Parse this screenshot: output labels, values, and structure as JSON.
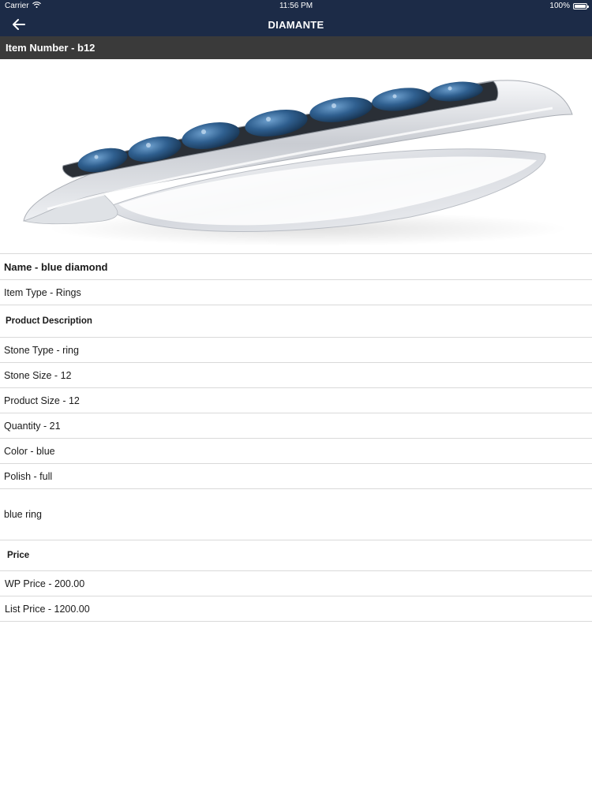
{
  "status_bar": {
    "carrier": "Carrier",
    "time": "11:56 PM",
    "battery_text": "100%"
  },
  "nav": {
    "title": "DIAMANTE",
    "back_icon": "arrow-left-icon"
  },
  "header": {
    "item_number": "Item Number - b12"
  },
  "product_image": {
    "icon": "ring-product-image",
    "colors": {
      "metal": "#e9ecef",
      "stone": "#2f5f8f"
    }
  },
  "details": {
    "name": "Name - blue diamond",
    "item_type": "Item Type - Rings",
    "description_heading": "Product Description",
    "stone_type": "Stone Type - ring",
    "stone_size": "Stone Size - 12",
    "product_size": "Product Size - 12",
    "quantity": "Quantity - 21",
    "color": "Color - blue",
    "polish": "Polish - full",
    "description": "blue ring",
    "price_heading": "Price",
    "wp_price": "WP Price - 200.00",
    "list_price": "List Price - 1200.00"
  },
  "theme": {
    "navbar": "#1c2b47",
    "subheader": "#3a3a3a",
    "divider": "#d9d9d9"
  }
}
